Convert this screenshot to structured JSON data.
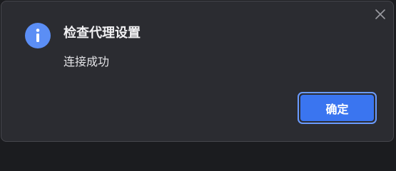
{
  "dialog": {
    "title": "检查代理设置",
    "message": "连接成功",
    "ok_label": "确定"
  },
  "icons": {
    "info": "info-icon",
    "close": "close-icon"
  },
  "colors": {
    "background": "#2b2c31",
    "accent": "#3a75f0",
    "info_icon": "#5b8ef5"
  }
}
